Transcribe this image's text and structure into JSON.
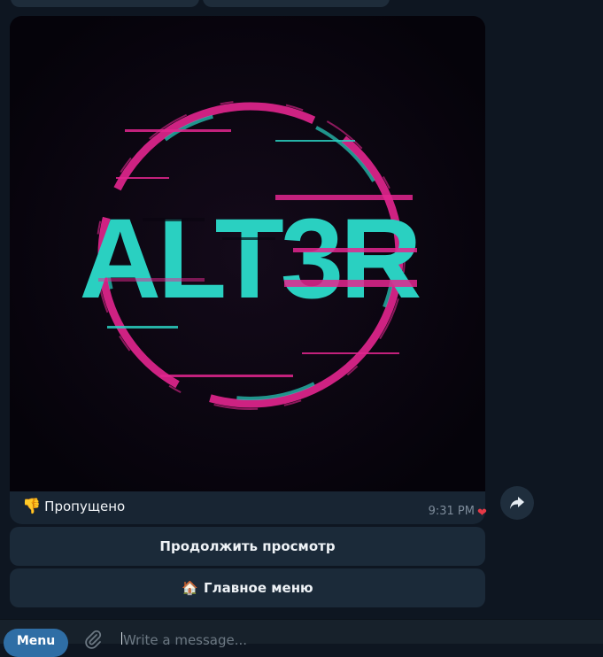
{
  "message": {
    "image": {
      "logo_text": "ALT3R"
    },
    "caption": {
      "emoji": "👎",
      "text": "Пропущено"
    },
    "time": "9:31 PM",
    "reaction": "❤"
  },
  "keyboard": [
    {
      "label": "Продолжить просмотр",
      "emoji": ""
    },
    {
      "label": "Главное меню",
      "emoji": "🏠"
    }
  ],
  "composer": {
    "menu_label": "Menu",
    "placeholder": "Write a message..."
  },
  "icons": [
    "forward-icon",
    "attach-icon",
    "heart-icon",
    "thumbs-down-icon",
    "house-icon"
  ],
  "colors": {
    "background": "#0e1621",
    "bubble": "#182533",
    "button": "#1b2a39",
    "accent": "#2f6ea5",
    "logo_teal": "#2ad0c1",
    "logo_pink": "#e3268f"
  }
}
